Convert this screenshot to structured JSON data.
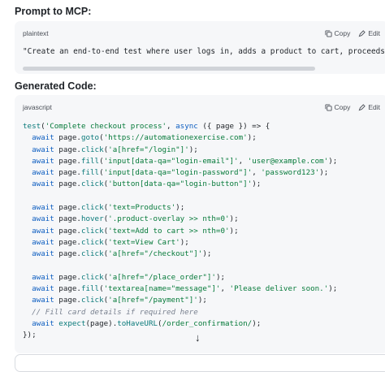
{
  "section1": {
    "heading": "Prompt to MCP:",
    "lang": "plaintext",
    "copy": "Copy",
    "edit": "Edit",
    "text": "\"Create an end-to-end test where user logs in, adds a product to cart, proceeds to checkout"
  },
  "section2": {
    "heading": "Generated Code:",
    "lang": "javascript",
    "copy": "Copy",
    "edit": "Edit"
  },
  "code": [
    [
      [
        "f",
        "test"
      ],
      [
        "p",
        "("
      ],
      [
        "s",
        "'Complete checkout process'"
      ],
      [
        "p",
        ", "
      ],
      [
        "k",
        "async"
      ],
      [
        "p",
        " ({ page }) => {"
      ]
    ],
    [
      [
        "p",
        "  "
      ],
      [
        "k",
        "await"
      ],
      [
        "p",
        " page."
      ],
      [
        "f",
        "goto"
      ],
      [
        "p",
        "("
      ],
      [
        "s",
        "'https://automationexercise.com'"
      ],
      [
        "p",
        ");"
      ]
    ],
    [
      [
        "p",
        "  "
      ],
      [
        "k",
        "await"
      ],
      [
        "p",
        " page."
      ],
      [
        "f",
        "click"
      ],
      [
        "p",
        "("
      ],
      [
        "s",
        "'a[href=\"/login\"]'"
      ],
      [
        "p",
        ");"
      ]
    ],
    [
      [
        "p",
        "  "
      ],
      [
        "k",
        "await"
      ],
      [
        "p",
        " page."
      ],
      [
        "f",
        "fill"
      ],
      [
        "p",
        "("
      ],
      [
        "s",
        "'input[data-qa=\"login-email\"]'"
      ],
      [
        "p",
        ", "
      ],
      [
        "s",
        "'user@example.com'"
      ],
      [
        "p",
        ");"
      ]
    ],
    [
      [
        "p",
        "  "
      ],
      [
        "k",
        "await"
      ],
      [
        "p",
        " page."
      ],
      [
        "f",
        "fill"
      ],
      [
        "p",
        "("
      ],
      [
        "s",
        "'input[data-qa=\"login-password\"]'"
      ],
      [
        "p",
        ", "
      ],
      [
        "s",
        "'password123'"
      ],
      [
        "p",
        ");"
      ]
    ],
    [
      [
        "p",
        "  "
      ],
      [
        "k",
        "await"
      ],
      [
        "p",
        " page."
      ],
      [
        "f",
        "click"
      ],
      [
        "p",
        "("
      ],
      [
        "s",
        "'button[data-qa=\"login-button\"]'"
      ],
      [
        "p",
        ");"
      ]
    ],
    [
      [
        "p",
        ""
      ]
    ],
    [
      [
        "p",
        "  "
      ],
      [
        "k",
        "await"
      ],
      [
        "p",
        " page."
      ],
      [
        "f",
        "click"
      ],
      [
        "p",
        "("
      ],
      [
        "s",
        "'text=Products'"
      ],
      [
        "p",
        ");"
      ]
    ],
    [
      [
        "p",
        "  "
      ],
      [
        "k",
        "await"
      ],
      [
        "p",
        " page."
      ],
      [
        "f",
        "hover"
      ],
      [
        "p",
        "("
      ],
      [
        "s",
        "'.product-overlay >> nth=0'"
      ],
      [
        "p",
        ");"
      ]
    ],
    [
      [
        "p",
        "  "
      ],
      [
        "k",
        "await"
      ],
      [
        "p",
        " page."
      ],
      [
        "f",
        "click"
      ],
      [
        "p",
        "("
      ],
      [
        "s",
        "'text=Add to cart >> nth=0'"
      ],
      [
        "p",
        ");"
      ]
    ],
    [
      [
        "p",
        "  "
      ],
      [
        "k",
        "await"
      ],
      [
        "p",
        " page."
      ],
      [
        "f",
        "click"
      ],
      [
        "p",
        "("
      ],
      [
        "s",
        "'text=View Cart'"
      ],
      [
        "p",
        ");"
      ]
    ],
    [
      [
        "p",
        "  "
      ],
      [
        "k",
        "await"
      ],
      [
        "p",
        " page."
      ],
      [
        "f",
        "click"
      ],
      [
        "p",
        "("
      ],
      [
        "s",
        "'a[href=\"/checkout\"]'"
      ],
      [
        "p",
        ");"
      ]
    ],
    [
      [
        "p",
        ""
      ]
    ],
    [
      [
        "p",
        "  "
      ],
      [
        "k",
        "await"
      ],
      [
        "p",
        " page."
      ],
      [
        "f",
        "click"
      ],
      [
        "p",
        "("
      ],
      [
        "s",
        "'a[href=\"/place_order\"]'"
      ],
      [
        "p",
        ");"
      ]
    ],
    [
      [
        "p",
        "  "
      ],
      [
        "k",
        "await"
      ],
      [
        "p",
        " page."
      ],
      [
        "f",
        "fill"
      ],
      [
        "p",
        "("
      ],
      [
        "s",
        "'textarea[name=\"message\"]'"
      ],
      [
        "p",
        ", "
      ],
      [
        "s",
        "'Please deliver soon.'"
      ],
      [
        "p",
        ");"
      ]
    ],
    [
      [
        "p",
        "  "
      ],
      [
        "k",
        "await"
      ],
      [
        "p",
        " page."
      ],
      [
        "f",
        "click"
      ],
      [
        "p",
        "("
      ],
      [
        "s",
        "'a[href=\"/payment\"]'"
      ],
      [
        "p",
        ");"
      ]
    ],
    [
      [
        "c",
        "  // Fill card details if required here"
      ]
    ],
    [
      [
        "p",
        "  "
      ],
      [
        "k",
        "await"
      ],
      [
        "p",
        " "
      ],
      [
        "f",
        "expect"
      ],
      [
        "p",
        "(page)."
      ],
      [
        "f",
        "toHaveURL"
      ],
      [
        "p",
        "("
      ],
      [
        "s",
        "/order_confirmation/"
      ],
      [
        "p",
        ");"
      ]
    ],
    [
      [
        "p",
        "});"
      ]
    ]
  ],
  "icons": {
    "copy": "copy-icon",
    "edit": "pencil-icon",
    "scroll": "arrow-down-icon"
  },
  "scroll_glyph": "↓"
}
